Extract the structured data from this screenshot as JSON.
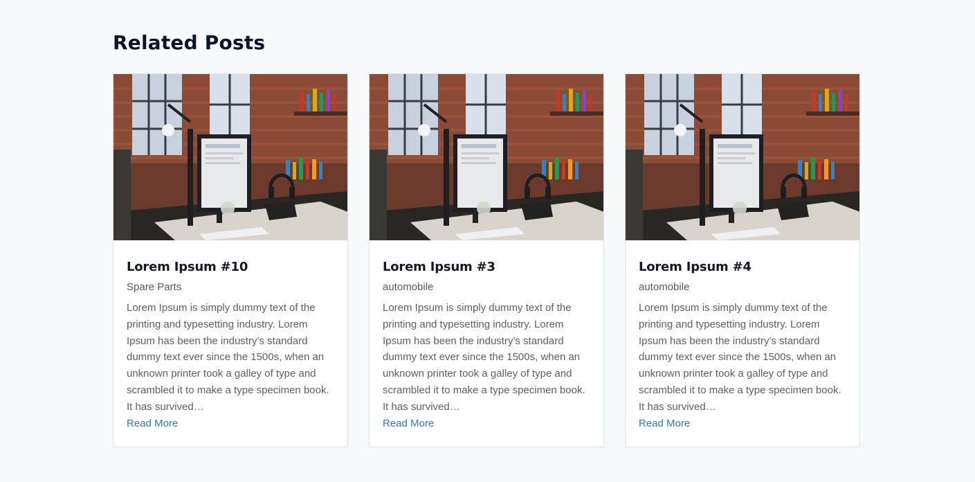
{
  "section": {
    "title": "Related Posts"
  },
  "posts": [
    {
      "title": "Lorem Ipsum #10",
      "category": "Spare Parts",
      "excerpt": "Lorem Ipsum is simply dummy text of the printing and typesetting industry. Lorem Ipsum has been the industry’s standard dummy text ever since the 1500s, when an unknown printer took a galley of type and scrambled it to make a type specimen book. It has survived…",
      "read_more_label": "Read More"
    },
    {
      "title": "Lorem Ipsum #3",
      "category": "automobile",
      "excerpt": "Lorem Ipsum is simply dummy text of the printing and typesetting industry. Lorem Ipsum has been the industry’s standard dummy text ever since the 1500s, when an unknown printer took a galley of type and scrambled it to make a type specimen book. It has survived…",
      "read_more_label": "Read More"
    },
    {
      "title": "Lorem Ipsum #4",
      "category": "automobile",
      "excerpt": "Lorem Ipsum is simply dummy text of the printing and typesetting industry. Lorem Ipsum has been the industry’s standard dummy text ever since the 1500s, when an unknown printer took a galley of type and scrambled it to make a type specimen book. It has survived…",
      "read_more_label": "Read More"
    }
  ],
  "colors": {
    "page_background": "#f8f9fb",
    "card_border": "#dcdfe4",
    "title_text": "#141824",
    "link": "#2e77c9"
  }
}
